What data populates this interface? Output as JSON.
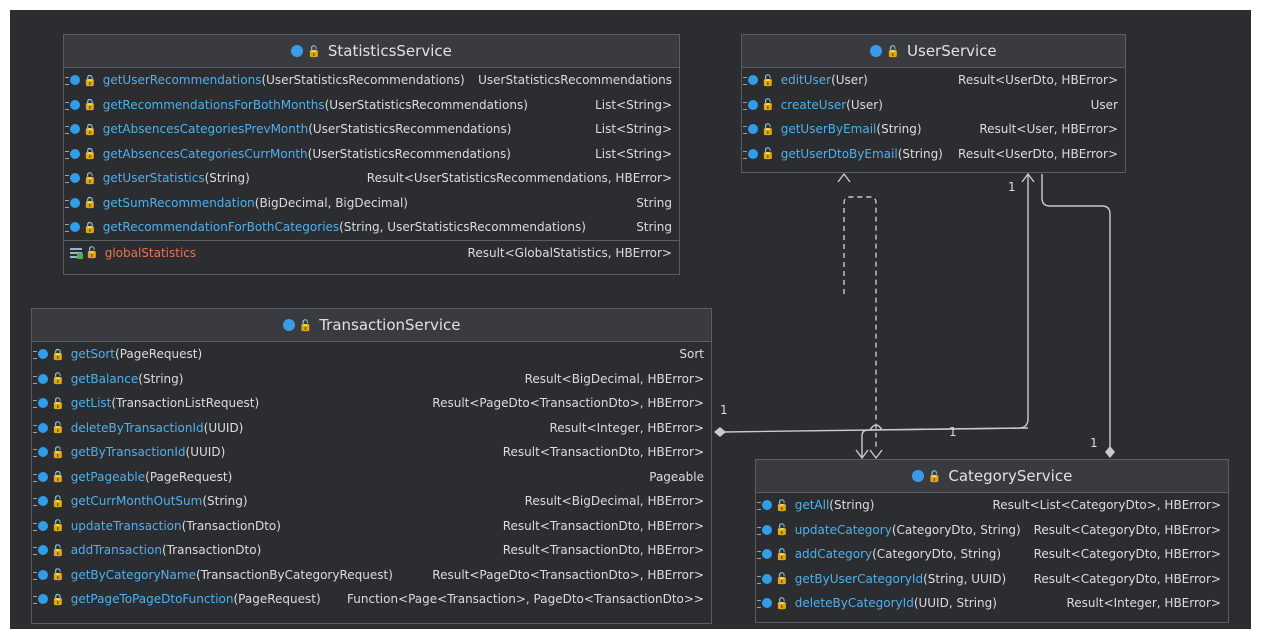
{
  "colors": {
    "background": "#2b2d30",
    "header": "#393b40",
    "border": "#5a5d63",
    "method_name": "#4fb0ee",
    "field_name": "#e8734f",
    "class_icon": "#3c9be8",
    "public_lock": "#c7d96a",
    "private_lock": "#e05b5b"
  },
  "classes": {
    "statistics": {
      "name": "StatisticsService",
      "members": [
        {
          "kind": "method",
          "visibility": "private",
          "name": "getUserRecommendations",
          "params": "(UserStatisticsRecommendations)",
          "type": "UserStatisticsRecommendations"
        },
        {
          "kind": "method",
          "visibility": "private",
          "name": "getRecommendationsForBothMonths",
          "params": "(UserStatisticsRecommendations)",
          "type": "List<String>"
        },
        {
          "kind": "method",
          "visibility": "private",
          "name": "getAbsencesCategoriesPrevMonth",
          "params": "(UserStatisticsRecommendations)",
          "type": "List<String>"
        },
        {
          "kind": "method",
          "visibility": "private",
          "name": "getAbsencesCategoriesCurrMonth",
          "params": "(UserStatisticsRecommendations)",
          "type": "List<String>"
        },
        {
          "kind": "method",
          "visibility": "public",
          "name": "getUserStatistics",
          "params": "(String)",
          "type": "Result<UserStatisticsRecommendations, HBError>"
        },
        {
          "kind": "method",
          "visibility": "private",
          "name": "getSumRecommendation",
          "params": "(BigDecimal, BigDecimal)",
          "type": "String"
        },
        {
          "kind": "method",
          "visibility": "private",
          "name": "getRecommendationForBothCategories",
          "params": "(String, UserStatisticsRecommendations)",
          "type": "String"
        },
        {
          "kind": "field",
          "visibility": "public",
          "name": "globalStatistics",
          "params": "",
          "type": "Result<GlobalStatistics, HBError>"
        }
      ]
    },
    "user": {
      "name": "UserService",
      "members": [
        {
          "kind": "method",
          "visibility": "public",
          "name": "editUser",
          "params": "(User)",
          "type": "Result<UserDto, HBError>"
        },
        {
          "kind": "method",
          "visibility": "public",
          "name": "createUser",
          "params": "(User)",
          "type": "User"
        },
        {
          "kind": "method",
          "visibility": "public",
          "name": "getUserByEmail",
          "params": "(String)",
          "type": "Result<User, HBError>"
        },
        {
          "kind": "method",
          "visibility": "public",
          "name": "getUserDtoByEmail",
          "params": "(String)",
          "type": "Result<UserDto, HBError>"
        }
      ]
    },
    "transaction": {
      "name": "TransactionService",
      "members": [
        {
          "kind": "method",
          "visibility": "private",
          "name": "getSort",
          "params": "(PageRequest)",
          "type": "Sort"
        },
        {
          "kind": "method",
          "visibility": "public",
          "name": "getBalance",
          "params": "(String)",
          "type": "Result<BigDecimal, HBError>"
        },
        {
          "kind": "method",
          "visibility": "public",
          "name": "getList",
          "params": "(TransactionListRequest)",
          "type": "Result<PageDto<TransactionDto>, HBError>"
        },
        {
          "kind": "method",
          "visibility": "public",
          "name": "deleteByTransactionId",
          "params": "(UUID)",
          "type": "Result<Integer, HBError>"
        },
        {
          "kind": "method",
          "visibility": "public",
          "name": "getByTransactionId",
          "params": "(UUID)",
          "type": "Result<TransactionDto, HBError>"
        },
        {
          "kind": "method",
          "visibility": "private",
          "name": "getPageable",
          "params": "(PageRequest)",
          "type": "Pageable"
        },
        {
          "kind": "method",
          "visibility": "public",
          "name": "getCurrMonthOutSum",
          "params": "(String)",
          "type": "Result<BigDecimal, HBError>"
        },
        {
          "kind": "method",
          "visibility": "public",
          "name": "updateTransaction",
          "params": "(TransactionDto)",
          "type": "Result<TransactionDto, HBError>"
        },
        {
          "kind": "method",
          "visibility": "public",
          "name": "addTransaction",
          "params": "(TransactionDto)",
          "type": "Result<TransactionDto, HBError>"
        },
        {
          "kind": "method",
          "visibility": "public",
          "name": "getByCategoryName",
          "params": "(TransactionByCategoryRequest)",
          "type": "Result<PageDto<TransactionDto>, HBError>"
        },
        {
          "kind": "method",
          "visibility": "private",
          "name": "getPageToPageDtoFunction",
          "params": "(PageRequest)",
          "type": "Function<Page<Transaction>, PageDto<TransactionDto>>"
        }
      ]
    },
    "category": {
      "name": "CategoryService",
      "members": [
        {
          "kind": "method",
          "visibility": "public",
          "name": "getAll",
          "params": "(String)",
          "type": "Result<List<CategoryDto>, HBError>"
        },
        {
          "kind": "method",
          "visibility": "public",
          "name": "updateCategory",
          "params": "(CategoryDto, String)",
          "type": "Result<CategoryDto, HBError>"
        },
        {
          "kind": "method",
          "visibility": "public",
          "name": "addCategory",
          "params": "(CategoryDto, String)",
          "type": "Result<CategoryDto, HBError>"
        },
        {
          "kind": "method",
          "visibility": "public",
          "name": "getByUserCategoryId",
          "params": "(String, UUID)",
          "type": "Result<CategoryDto, HBError>"
        },
        {
          "kind": "method",
          "visibility": "public",
          "name": "deleteByCategoryId",
          "params": "(UUID, String)",
          "type": "Result<Integer, HBError>"
        }
      ]
    }
  },
  "multiplicities": {
    "user_side": "1",
    "transaction_side": "1",
    "edge_middle": "1",
    "category_side": "1"
  }
}
